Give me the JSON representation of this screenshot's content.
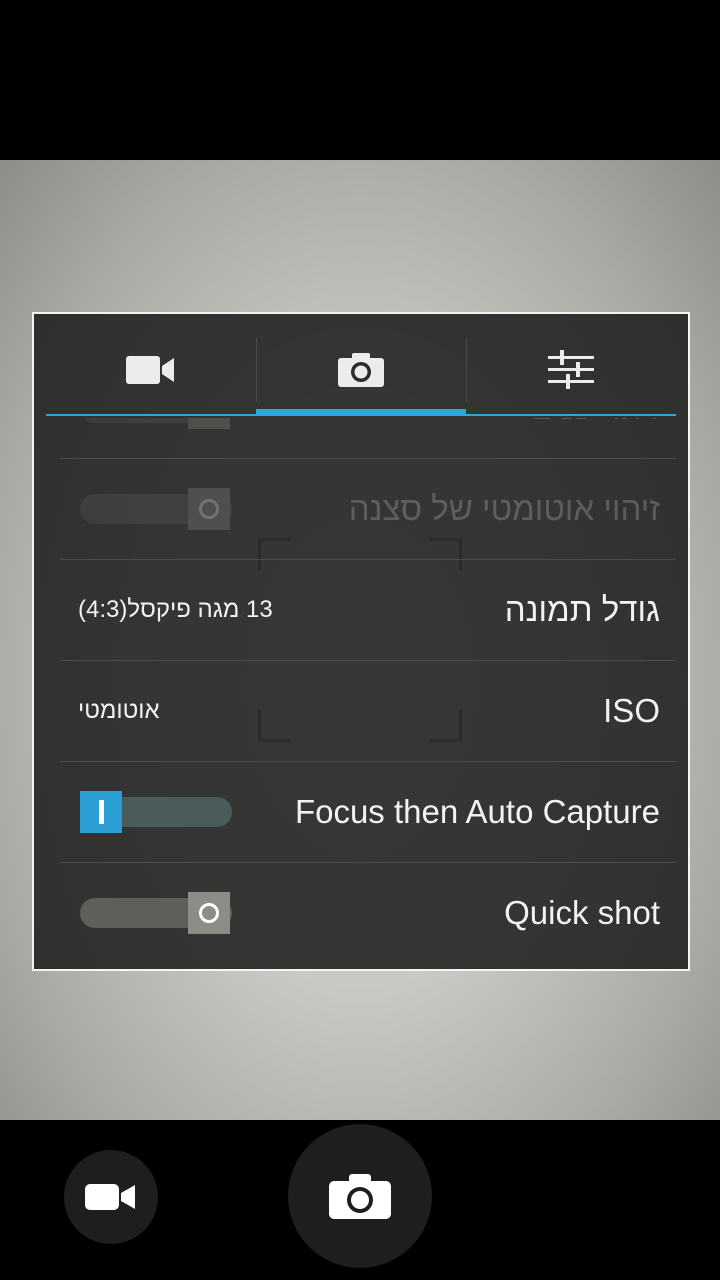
{
  "settings_panel": {
    "tabs": [
      {
        "icon": "video-camera-icon",
        "selected": false
      },
      {
        "icon": "camera-icon",
        "selected": true
      },
      {
        "icon": "sliders-icon",
        "selected": false
      }
    ],
    "rows": [
      {
        "label": "זיהוי פנים",
        "control": "switch-off",
        "faded": true
      },
      {
        "label": "זיהוי אוטומטי של סצנה",
        "control": "switch-off",
        "faded": true
      },
      {
        "label": "גודל תמונה",
        "value": "13 מגה פיקסל(4:3)"
      },
      {
        "label": "ISO",
        "value": "אוטומטי"
      },
      {
        "label": "Focus then Auto Capture",
        "control": "switch-on"
      },
      {
        "label": "Quick shot",
        "control": "switch-off"
      }
    ]
  },
  "bottom_controls": {
    "video_button_icon": "video-camera-icon",
    "shutter_button_icon": "camera-icon"
  },
  "colors": {
    "accent": "#2fa6d8",
    "panel_border": "#f4f4f4",
    "switch_on": "#2a9ed3"
  }
}
